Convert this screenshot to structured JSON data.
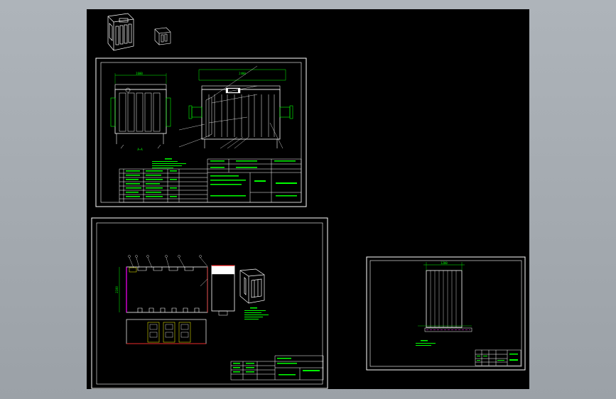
{
  "colors": {
    "background": "#000000",
    "frame": "#ffffff",
    "dim": "#00ff00",
    "accent": "#ff0000",
    "magenta": "#ff00ff",
    "cyan": "#00ffff",
    "yellow": "#ffff00"
  },
  "icons": [
    "cabinet-3d-icon",
    "small-cabinet-3d-icon",
    "housing-3d-icon"
  ],
  "sheet1": {
    "label_a": "A—A"
  }
}
